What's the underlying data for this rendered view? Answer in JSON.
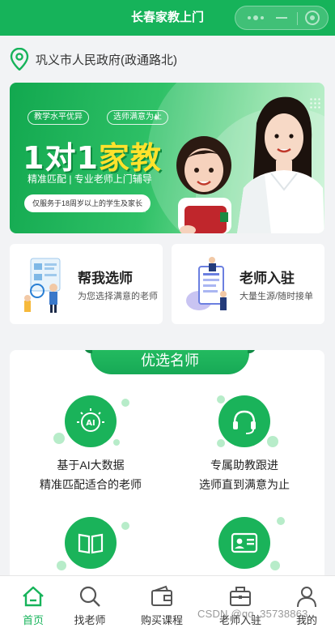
{
  "header": {
    "title": "长春家教上门",
    "accent": "#16b35a"
  },
  "location": {
    "address": "巩义市人民政府(政通路北)"
  },
  "banner": {
    "tags": [
      "教学水平优异",
      "选师满意为止"
    ],
    "headline_parts": [
      "1对1",
      "家教"
    ],
    "subline": "精准匹配 | 专业老师上门辅导",
    "note": "仅服务于18周岁以上的学生及家长"
  },
  "cards": [
    {
      "title": "帮我选师",
      "subtitle": "为您选择满意的老师"
    },
    {
      "title": "老师入驻",
      "subtitle": "大量生源/随时接单"
    }
  ],
  "featured": {
    "title": "优选名师",
    "items": [
      {
        "icon": "ai-chip-icon",
        "line1": "基于AI大数据",
        "line2": "精准匹配适合的老师",
        "icon_text": "AI"
      },
      {
        "icon": "headset-icon",
        "line1": "专属助教跟进",
        "line2": "选师直到满意为止"
      },
      {
        "icon": "book-icon",
        "line1": "",
        "line2": ""
      },
      {
        "icon": "id-card-icon",
        "line1": "",
        "line2": ""
      }
    ]
  },
  "tabbar": {
    "items": [
      {
        "label": "首页",
        "icon": "home-icon",
        "active": true
      },
      {
        "label": "找老师",
        "icon": "search-icon",
        "active": false
      },
      {
        "label": "购买课程",
        "icon": "wallet-icon",
        "active": false
      },
      {
        "label": "老师入驻",
        "icon": "briefcase-icon",
        "active": false
      },
      {
        "label": "我的",
        "icon": "user-icon",
        "active": false
      }
    ]
  },
  "watermark": "CSDN @qq_35738863"
}
